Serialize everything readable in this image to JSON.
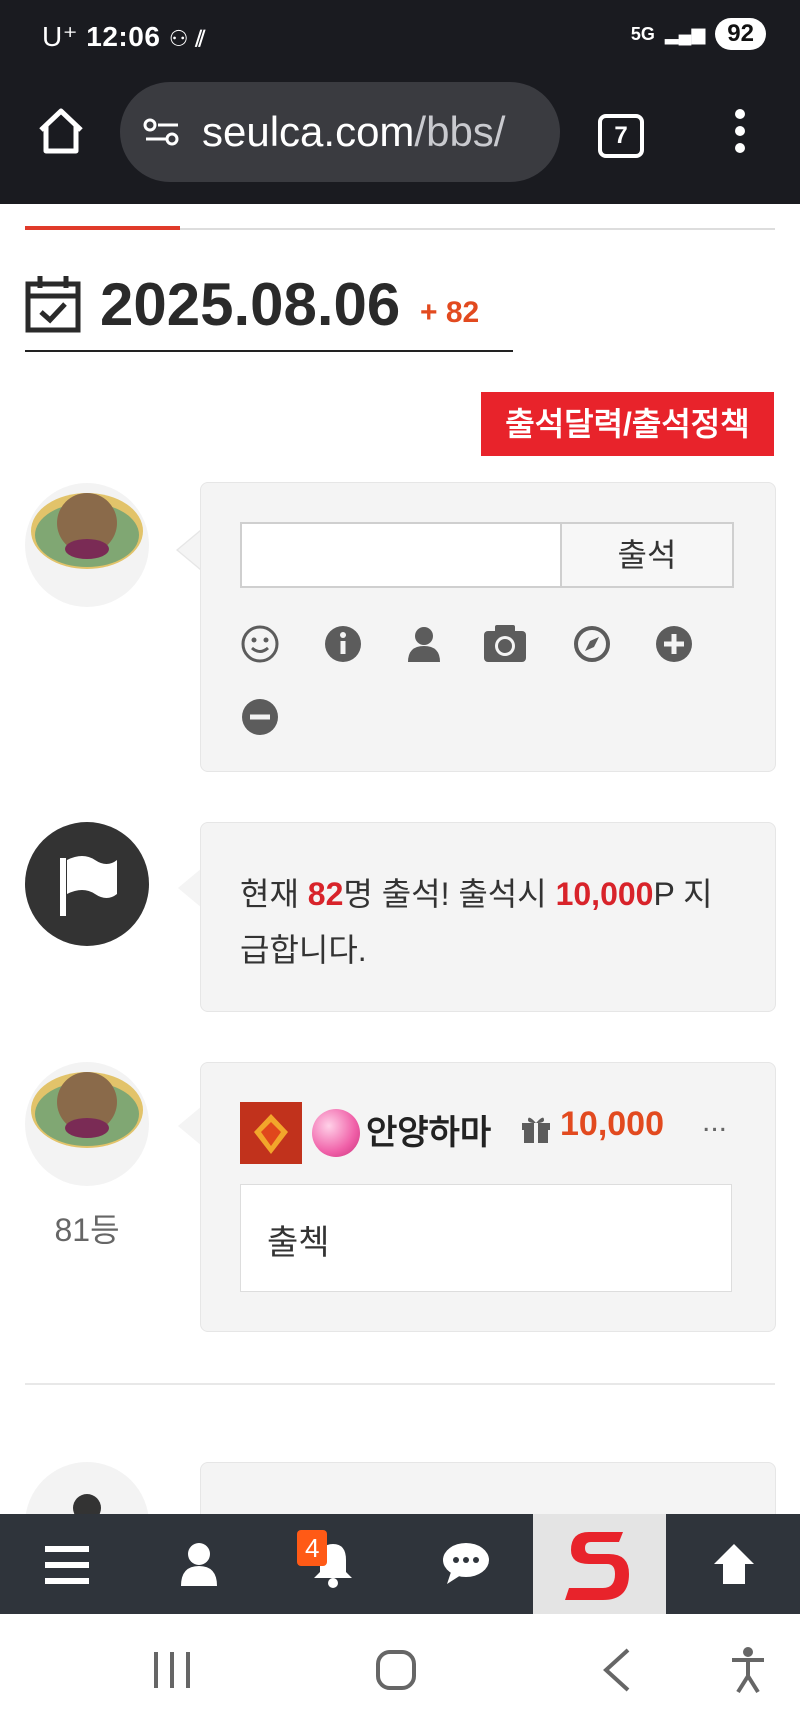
{
  "status_bar": {
    "carrier": "U⁺",
    "time": "12:06",
    "network": "5G",
    "battery": "92"
  },
  "browser": {
    "host": "seulca.com",
    "path": "/bbs/",
    "tab_count": "7"
  },
  "attendance": {
    "date": "2025.08.06",
    "increment": "+ 82",
    "calendar_button": "출석달력/출석정책",
    "submit_label": "출석",
    "notice": {
      "prefix": "현재 ",
      "count": "82",
      "mid": "명 출석! 출석시 ",
      "points": "10,000",
      "suffix": "P 지급합니다."
    }
  },
  "entry": {
    "username": "안양하마",
    "points": "10,000",
    "more": "...",
    "comment": "출첵",
    "rank": "81등"
  },
  "bottom_nav": {
    "notification_count": "4",
    "items": [
      "menu-icon",
      "user-icon",
      "bell-icon",
      "chat-icon",
      "site-logo",
      "arrow-up-icon"
    ]
  },
  "accent_colors": {
    "red": "#e8232b",
    "orange": "#e24a1f",
    "nav_bg": "#2f343b"
  }
}
